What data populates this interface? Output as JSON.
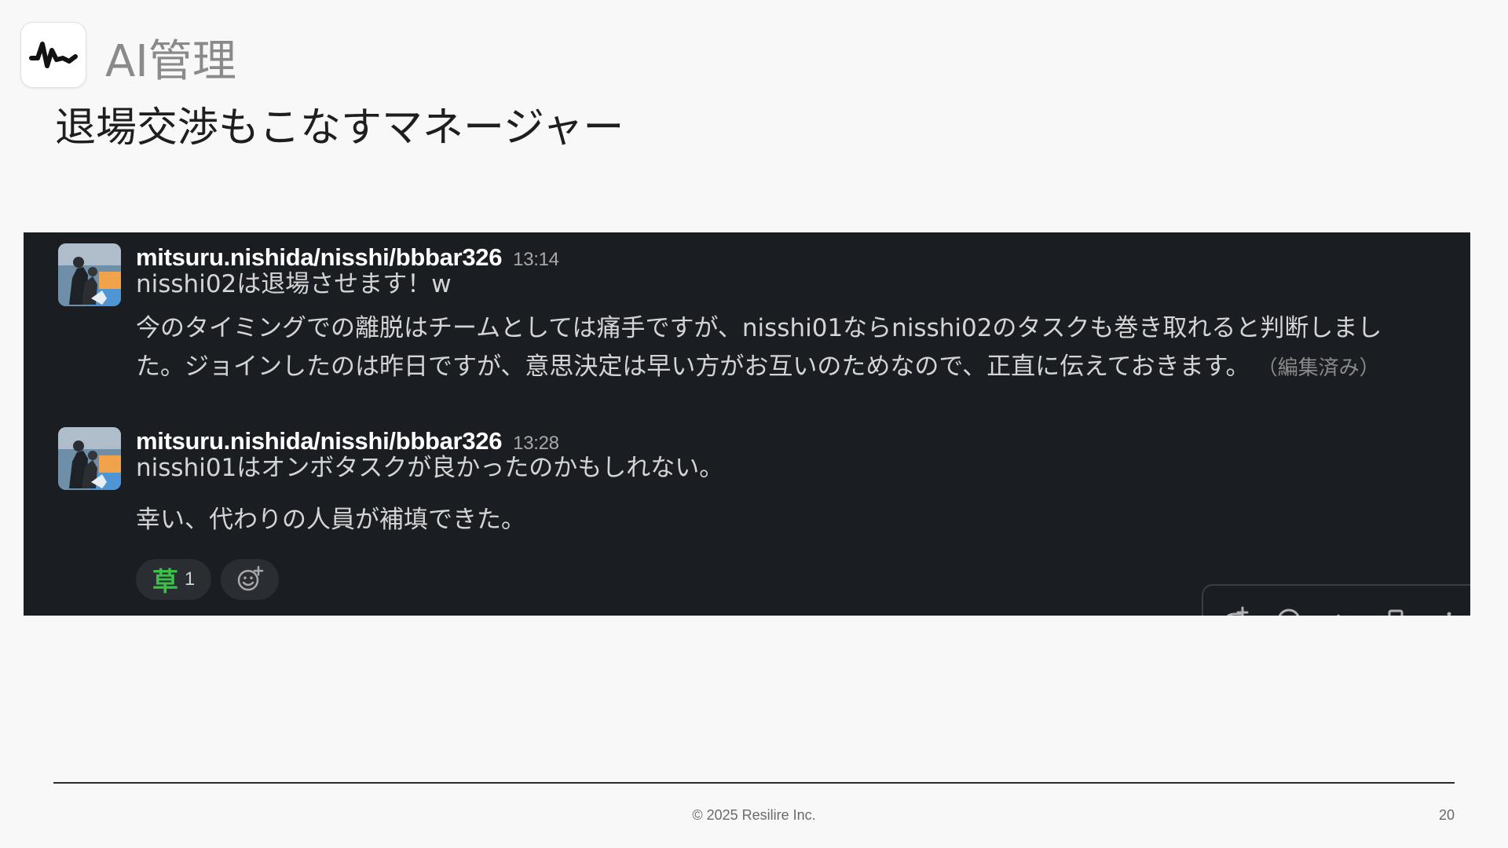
{
  "header": {
    "title": "AI管理",
    "subtitle": "退場交渉もこなすマネージャー"
  },
  "chat": {
    "messages": [
      {
        "user": "mitsuru.nishida/nisshi/bbbar326",
        "time": "13:14",
        "lines": [
          "nisshi02は退場させます！w",
          "今のタイミングでの離脱はチームとしては痛手ですが、nisshi01ならnisshi02のタスクも巻き取れると判断しまし",
          "た。ジョインしたのは昨日ですが、意思決定は早い方がお互いのためなので、正直に伝えておきます。"
        ],
        "edited": "（編集済み）"
      },
      {
        "user": "mitsuru.nishida/nisshi/bbbar326",
        "time": "13:28",
        "lines": [
          "nisshi01はオンボタスクが良かったのかもしれない。",
          "幸い、代わりの人員が補填できた。"
        ]
      }
    ],
    "reaction": {
      "emoji": "草",
      "count": "1"
    }
  },
  "footer": {
    "copyright": "© 2025 Resilire Inc.",
    "page": "20"
  },
  "colors": {
    "slide_background": "#f8f8f8",
    "chat_background": "#1a1d21",
    "reaction_green": "#3cc04a"
  }
}
